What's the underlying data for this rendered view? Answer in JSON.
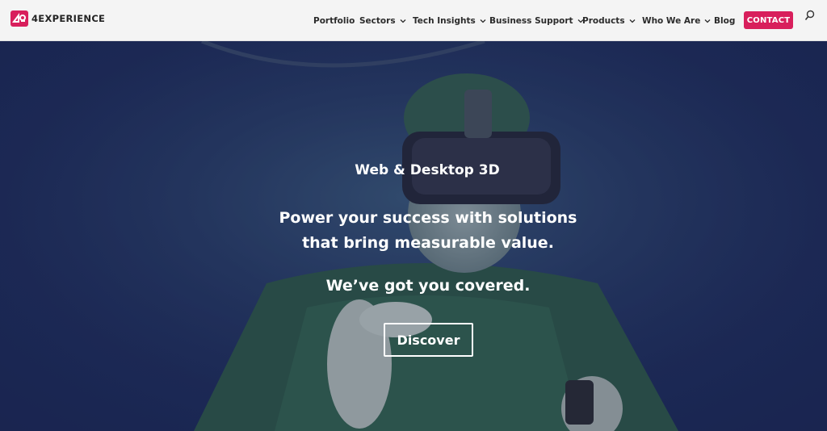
{
  "brand": {
    "name": "4EXPERIENCE",
    "accent": "#d81f5c"
  },
  "nav": {
    "items": [
      {
        "label": "Portfolio",
        "dropdown": false
      },
      {
        "label": "Sectors",
        "dropdown": true
      },
      {
        "label": "Tech Insights",
        "dropdown": true
      },
      {
        "label": "Business Support",
        "dropdown": true
      },
      {
        "label": "Products",
        "dropdown": true
      },
      {
        "label": "Who We Are",
        "dropdown": true
      },
      {
        "label": "Blog",
        "dropdown": false
      }
    ],
    "contact_label": "CONTACT",
    "search_icon": "search-icon"
  },
  "hero": {
    "tag": "Web & Desktop 3D",
    "headline_line1": "Power your success with solutions",
    "headline_line2": "that bring measurable value.",
    "subline": "We’ve got you covered.",
    "cta_label": "Discover"
  }
}
